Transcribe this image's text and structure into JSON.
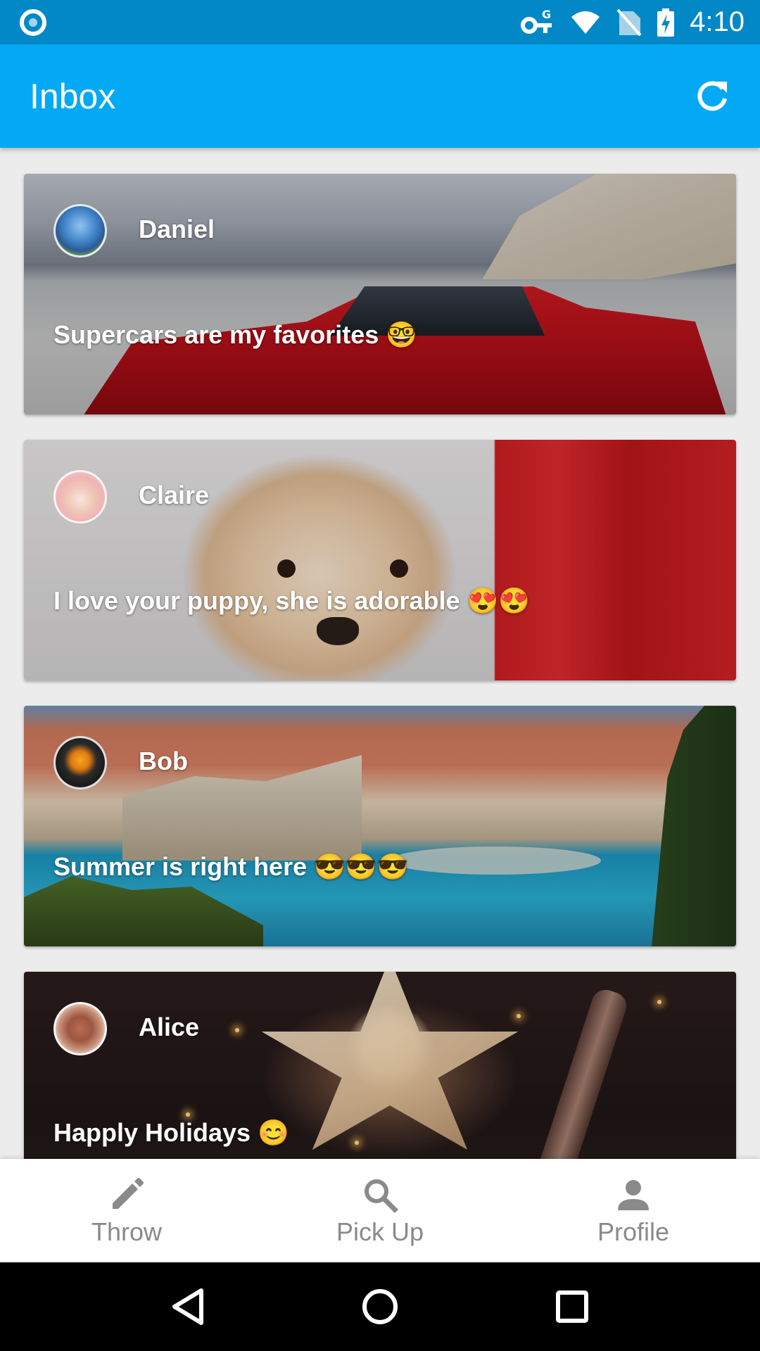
{
  "status_bar": {
    "time": "4:10"
  },
  "app_bar": {
    "title": "Inbox",
    "refresh_icon": "refresh-icon"
  },
  "messages": [
    {
      "sender": "Daniel",
      "text": "Supercars are my favorites 🤓"
    },
    {
      "sender": "Claire",
      "text": "I love your puppy, she is adorable 😍😍"
    },
    {
      "sender": "Bob",
      "text": "Summer is right here 😎😎😎"
    },
    {
      "sender": "Alice",
      "text": "Happly Holidays 😊"
    }
  ],
  "bottom_nav": {
    "items": [
      {
        "label": "Throw",
        "icon": "pencil-icon"
      },
      {
        "label": "Pick Up",
        "icon": "search-icon"
      },
      {
        "label": "Profile",
        "icon": "person-icon"
      }
    ]
  },
  "colors": {
    "status_bar": "#0288c6",
    "app_bar": "#03a9f4",
    "nav_label": "#8a8a8a"
  }
}
